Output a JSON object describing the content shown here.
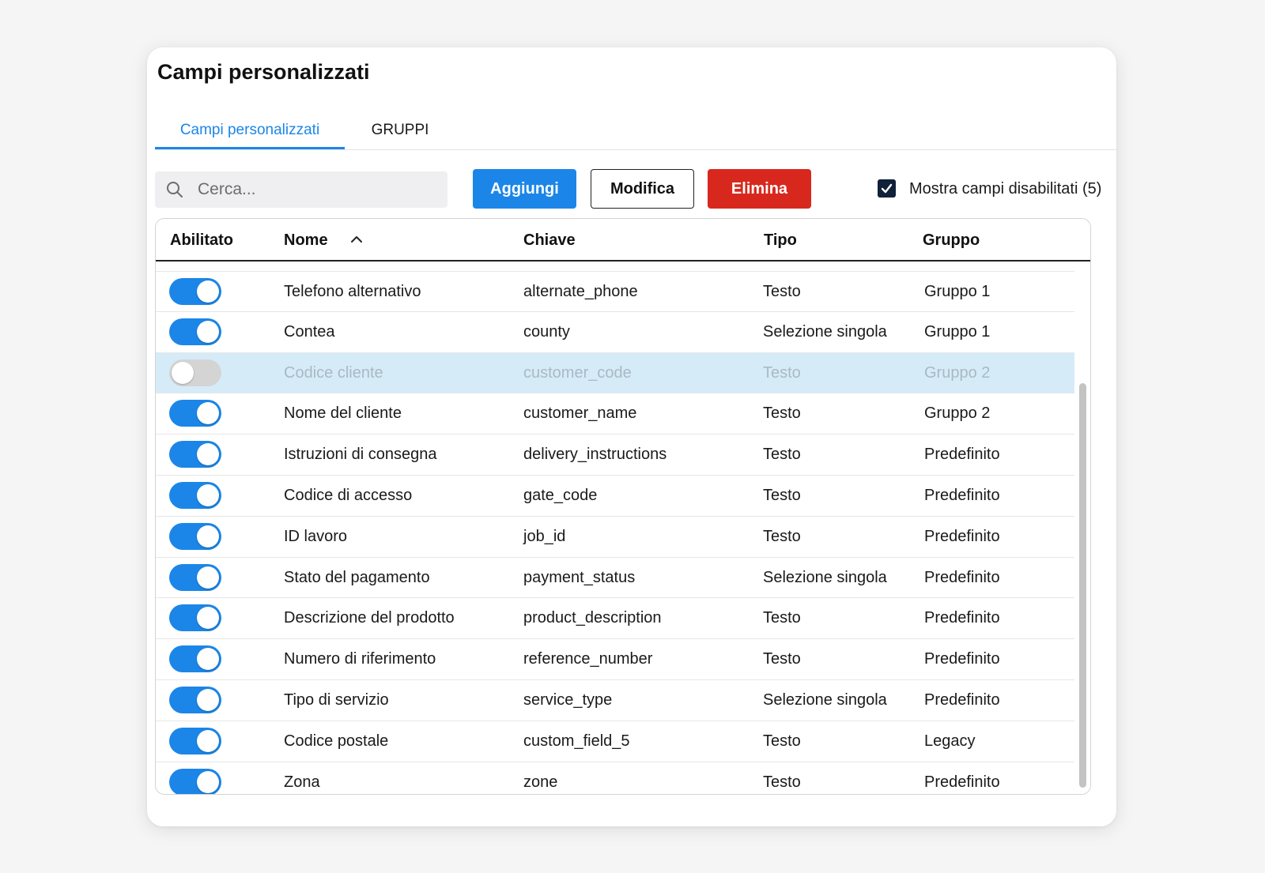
{
  "page": {
    "title": "Campi personalizzati",
    "tabs": [
      {
        "label": "Campi personalizzati",
        "active": true
      },
      {
        "label": "GRUPPI",
        "active": false
      }
    ]
  },
  "toolbar": {
    "search_placeholder": "Cerca...",
    "search_value": "",
    "add_label": "Aggiungi",
    "edit_label": "Modifica",
    "delete_label": "Elimina",
    "show_disabled_label": "Mostra campi disabilitati (5)",
    "show_disabled_checked": true
  },
  "table": {
    "columns": [
      "Abilitato",
      "Nome",
      "Chiave",
      "Tipo",
      "Gruppo"
    ],
    "sort": {
      "column": "Nome",
      "direction": "asc"
    },
    "rows": [
      {
        "enabled": true,
        "name": "Telefono alternativo",
        "key": "alternate_phone",
        "type": "Testo",
        "group": "Gruppo 1"
      },
      {
        "enabled": true,
        "name": "Contea",
        "key": "county",
        "type": "Selezione singola",
        "group": "Gruppo 1"
      },
      {
        "enabled": false,
        "name": "Codice cliente",
        "key": "customer_code",
        "type": "Testo",
        "group": "Gruppo 2"
      },
      {
        "enabled": true,
        "name": "Nome del cliente",
        "key": "customer_name",
        "type": "Testo",
        "group": "Gruppo 2"
      },
      {
        "enabled": true,
        "name": "Istruzioni di consegna",
        "key": "delivery_instructions",
        "type": "Testo",
        "group": "Predefinito"
      },
      {
        "enabled": true,
        "name": "Codice di accesso",
        "key": "gate_code",
        "type": "Testo",
        "group": "Predefinito"
      },
      {
        "enabled": true,
        "name": "ID lavoro",
        "key": "job_id",
        "type": "Testo",
        "group": "Predefinito"
      },
      {
        "enabled": true,
        "name": "Stato del pagamento",
        "key": "payment_status",
        "type": "Selezione singola",
        "group": "Predefinito"
      },
      {
        "enabled": true,
        "name": "Descrizione del prodotto",
        "key": "product_description",
        "type": "Testo",
        "group": "Predefinito"
      },
      {
        "enabled": true,
        "name": "Numero di riferimento",
        "key": "reference_number",
        "type": "Testo",
        "group": "Predefinito"
      },
      {
        "enabled": true,
        "name": "Tipo di servizio",
        "key": "service_type",
        "type": "Selezione singola",
        "group": "Predefinito"
      },
      {
        "enabled": true,
        "name": "Codice postale",
        "key": "custom_field_5",
        "type": "Testo",
        "group": "Legacy"
      },
      {
        "enabled": true,
        "name": "Zona",
        "key": "zone",
        "type": "Testo",
        "group": "Predefinito"
      }
    ]
  },
  "icons": {
    "search": "search-icon",
    "sort": "chevron-up-icon",
    "checkbox": "checkmark-icon"
  },
  "colors": {
    "accent": "#1b86e8",
    "danger": "#d8281e",
    "disabled_row": "#d6ebf8",
    "checkbox": "#11213a"
  }
}
